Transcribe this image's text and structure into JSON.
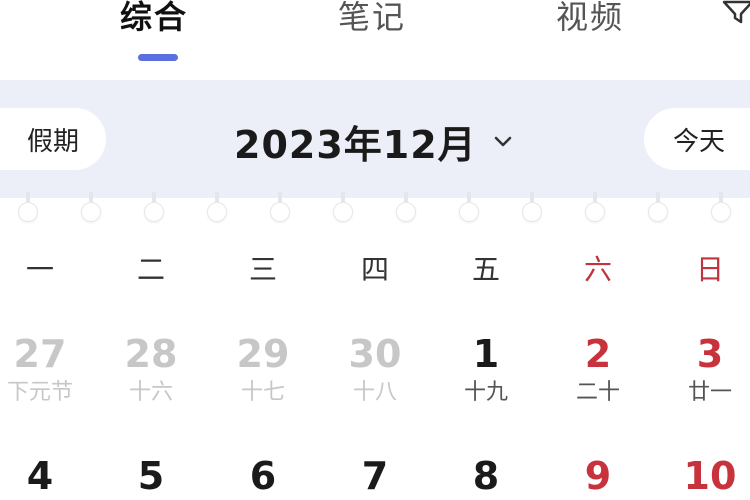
{
  "tabs": [
    {
      "label": "综合",
      "active": true
    },
    {
      "label": "笔记",
      "active": false
    },
    {
      "label": "视频",
      "active": false
    }
  ],
  "header": {
    "holiday_label": "假期",
    "month_title": "2023年12月",
    "today_label": "今天"
  },
  "weekdays": [
    "一",
    "二",
    "三",
    "四",
    "五",
    "六",
    "日"
  ],
  "week1": [
    {
      "day": "27",
      "lunar": "下元节",
      "muted": true
    },
    {
      "day": "28",
      "lunar": "十六",
      "muted": true
    },
    {
      "day": "29",
      "lunar": "十七",
      "muted": true
    },
    {
      "day": "30",
      "lunar": "十八",
      "muted": true
    },
    {
      "day": "1",
      "lunar": "十九",
      "muted": false
    },
    {
      "day": "2",
      "lunar": "二十",
      "muted": false
    },
    {
      "day": "3",
      "lunar": "廿一",
      "muted": false
    }
  ],
  "week2": [
    {
      "day": "4"
    },
    {
      "day": "5"
    },
    {
      "day": "6"
    },
    {
      "day": "7"
    },
    {
      "day": "8"
    },
    {
      "day": "9"
    },
    {
      "day": "10"
    }
  ],
  "colors": {
    "accent": "#5b6fe0",
    "weekend": "#c8323d",
    "band": "#eceef8",
    "muted": "#c7c7c7"
  }
}
